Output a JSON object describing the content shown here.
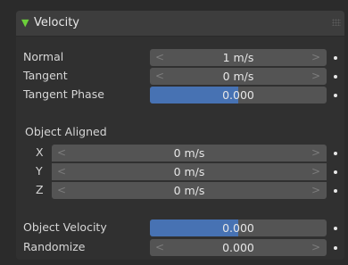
{
  "panel": {
    "title": "Velocity",
    "expand_icon": "triangle-down-icon",
    "drag_icon": "grip-dots-icon"
  },
  "fields": {
    "normal": {
      "label": "Normal",
      "value": "1 m/s"
    },
    "tangent": {
      "label": "Tangent",
      "value": "0 m/s"
    },
    "tangent_phase": {
      "label": "Tangent Phase",
      "value": "0.000",
      "fill_fraction": 0.5
    },
    "object_aligned": {
      "label": "Object Aligned"
    },
    "x": {
      "label": "X",
      "value": "0 m/s"
    },
    "y": {
      "label": "Y",
      "value": "0 m/s"
    },
    "z": {
      "label": "Z",
      "value": "0 m/s"
    },
    "object_velocity": {
      "label": "Object Velocity",
      "value": "0.000",
      "fill_fraction": 0.5
    },
    "randomize": {
      "label": "Randomize",
      "value": "0.000"
    }
  },
  "arrows": {
    "left": "<",
    "right": ">"
  },
  "colors": {
    "accent_fill": "#4772b3",
    "expand_triangle": "#6ccf3a",
    "field_bg": "#545454",
    "panel_bg": "#303030"
  }
}
